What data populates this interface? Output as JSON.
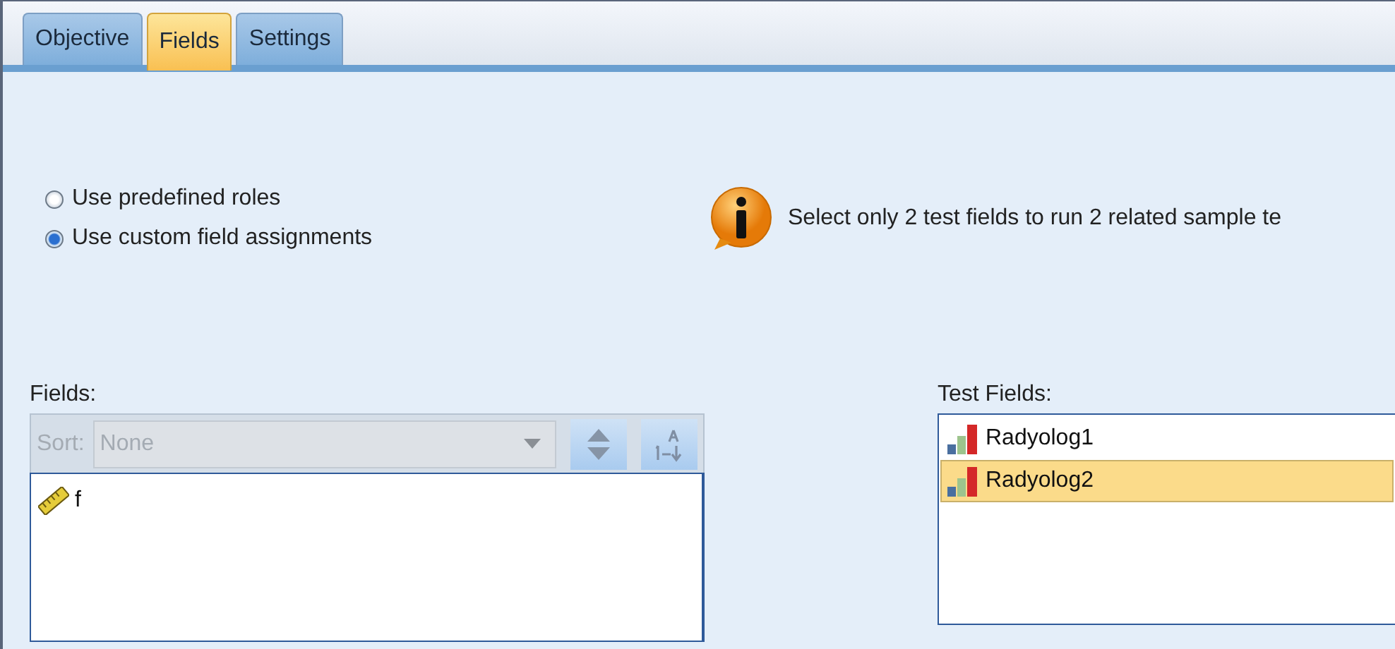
{
  "tabs": [
    {
      "label": "Objective",
      "selected": false
    },
    {
      "label": "Fields",
      "selected": true
    },
    {
      "label": "Settings",
      "selected": false
    }
  ],
  "role_options": [
    {
      "label": "Use predefined roles",
      "selected": false
    },
    {
      "label": "Use custom field assignments",
      "selected": true
    }
  ],
  "info_message": "Select only 2 test fields to run 2 related sample te",
  "fields_panel": {
    "label": "Fields:",
    "sort_label": "Sort:",
    "sort_value": "None",
    "disabled": true,
    "items": [
      {
        "name": "f",
        "kind": "scale"
      }
    ]
  },
  "test_fields_panel": {
    "label": "Test Fields:",
    "items": [
      {
        "name": "Radyolog1",
        "kind": "ordinal",
        "selected": false
      },
      {
        "name": "Radyolog2",
        "kind": "ordinal",
        "selected": true
      }
    ]
  }
}
